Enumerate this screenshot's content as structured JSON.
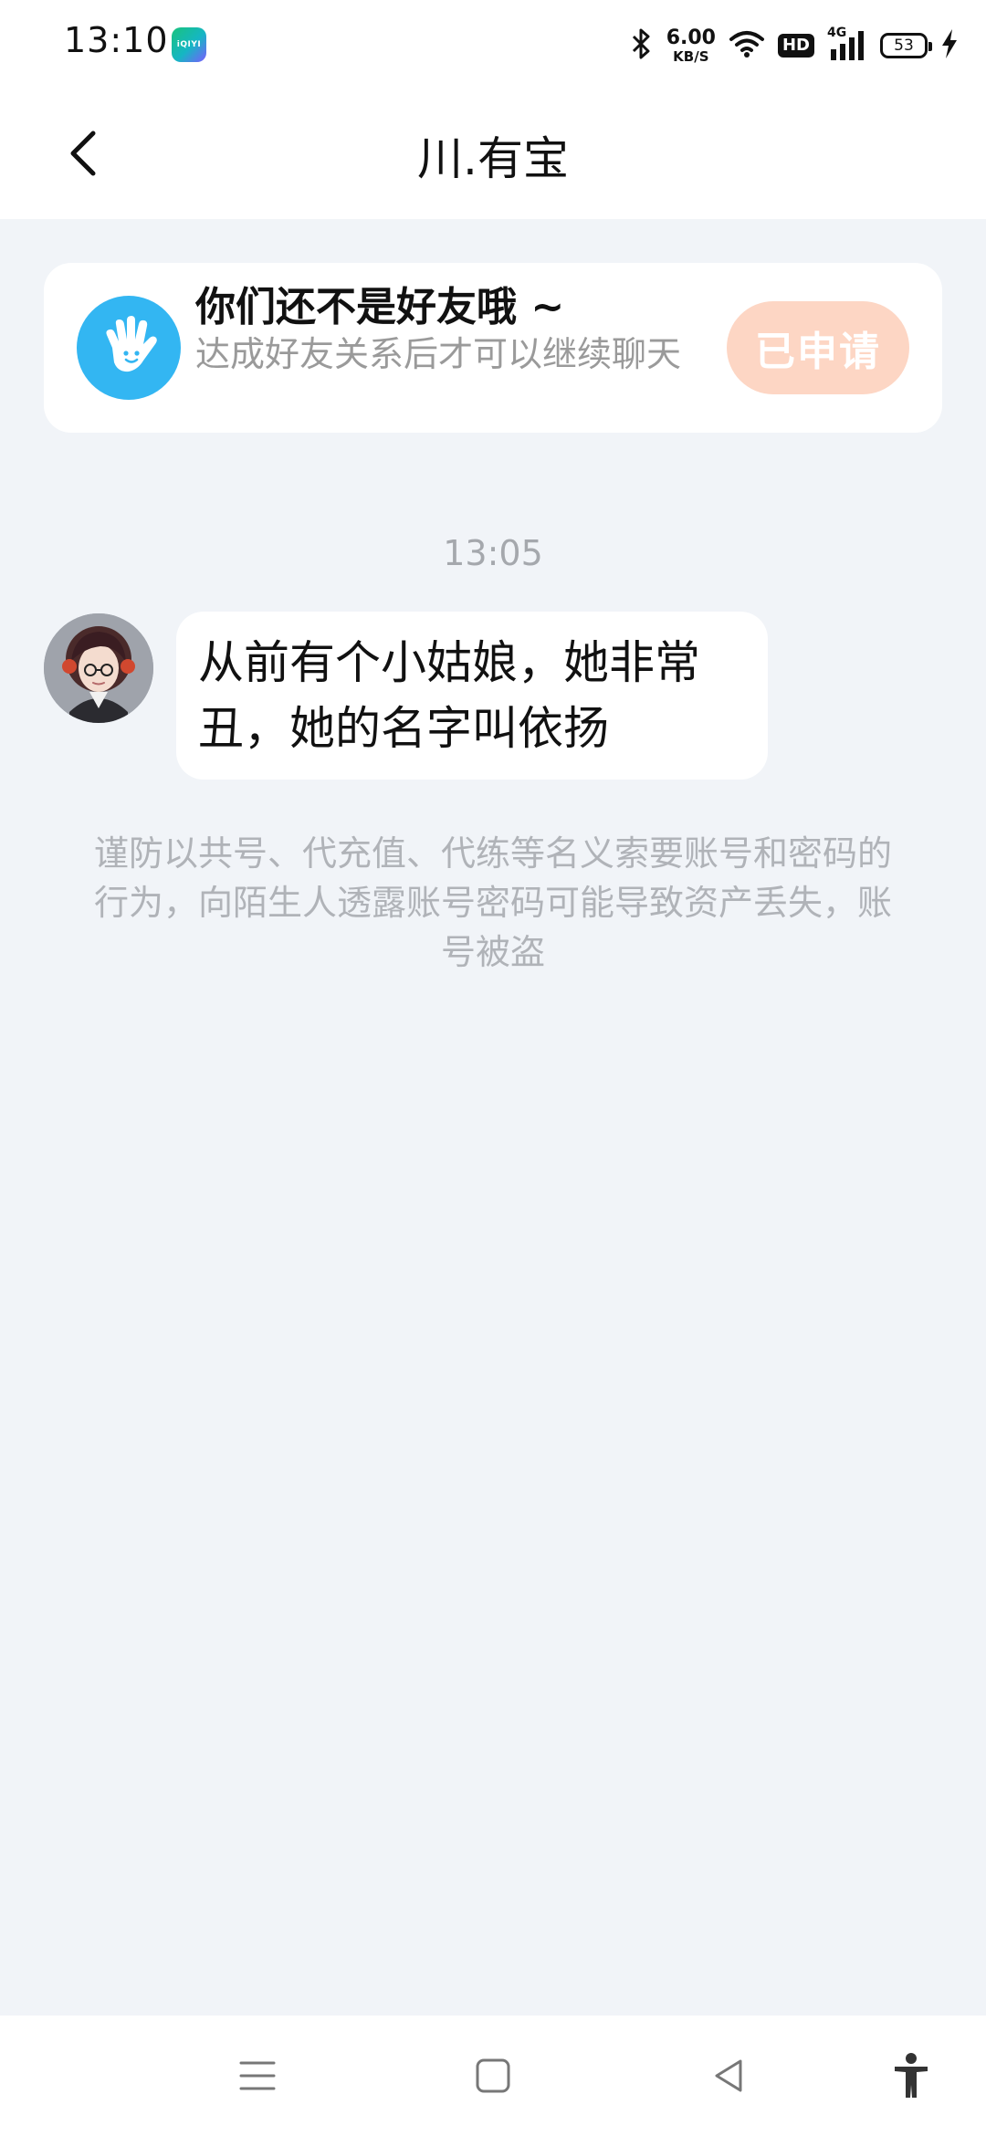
{
  "status_bar": {
    "time": "13:10",
    "app_badge": "iQIYI",
    "net_speed_value": "6.00",
    "net_speed_unit": "KB/S",
    "hd_label": "HD",
    "network_type": "4G",
    "battery_level": "53"
  },
  "header": {
    "title": "川.有宝"
  },
  "friend_notice": {
    "title": "你们还不是好友哦 ~",
    "subtitle": "达成好友关系后才可以继续聊天",
    "button_label": "已申请",
    "button_color": "#fdd6c4",
    "icon_color": "#33b6f2"
  },
  "chat": {
    "timestamp": "13:05",
    "messages": [
      {
        "text": "从前有个小姑娘，她非常丑，她的名字叫依扬"
      }
    ],
    "safety_tip": "谨防以共号、代充值、代练等名义索要账号和密码的行为，向陌生人透露账号密码可能导致资产丢失，账号被盗"
  },
  "colors": {
    "page_background": "#f1f4f8",
    "surface": "#ffffff",
    "muted_text": "#a5a8ad"
  }
}
